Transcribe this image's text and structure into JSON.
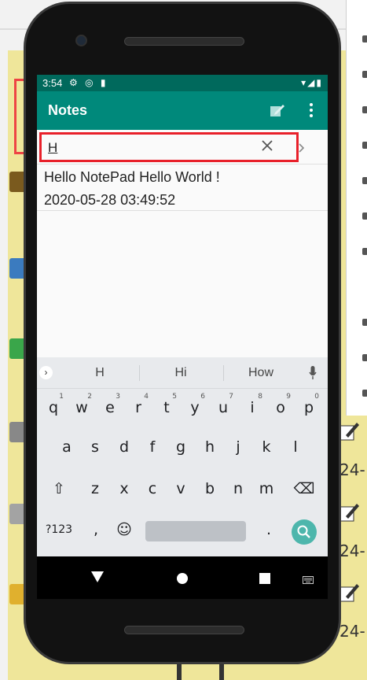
{
  "status_bar": {
    "time": "3:54",
    "left_icons": "⚙ ◎ ▮",
    "right_icons": "▾◢▮"
  },
  "app_bar": {
    "title": "Notes",
    "edit_icon": "edit-icon",
    "more_icon": "more-vert-icon"
  },
  "search": {
    "value": "H",
    "clear_icon": "close-icon",
    "go_icon": "chevron-right-icon"
  },
  "notes": [
    {
      "title": "Hello NotePad Hello World !",
      "date": "2020-05-28 03:49:52"
    }
  ],
  "keyboard": {
    "suggestions": [
      "H",
      "Hi",
      "How"
    ],
    "expand_label": "›",
    "row1": [
      "q",
      "w",
      "e",
      "r",
      "t",
      "y",
      "u",
      "i",
      "o",
      "p"
    ],
    "row1_digits": [
      "1",
      "2",
      "3",
      "4",
      "5",
      "6",
      "7",
      "8",
      "9",
      "0"
    ],
    "row2": [
      "a",
      "s",
      "d",
      "f",
      "g",
      "h",
      "j",
      "k",
      "l"
    ],
    "row3": [
      "z",
      "x",
      "c",
      "v",
      "b",
      "n",
      "m"
    ],
    "shift_label": "⇧",
    "backspace_label": "⌫",
    "symbols_label": "?123",
    "comma_label": ",",
    "emoji_label": "☺",
    "period_label": "."
  },
  "colors": {
    "status_bar": "#00695c",
    "app_bar": "#00897b",
    "highlight": "#e8202a",
    "search_key": "#4db6ac"
  }
}
